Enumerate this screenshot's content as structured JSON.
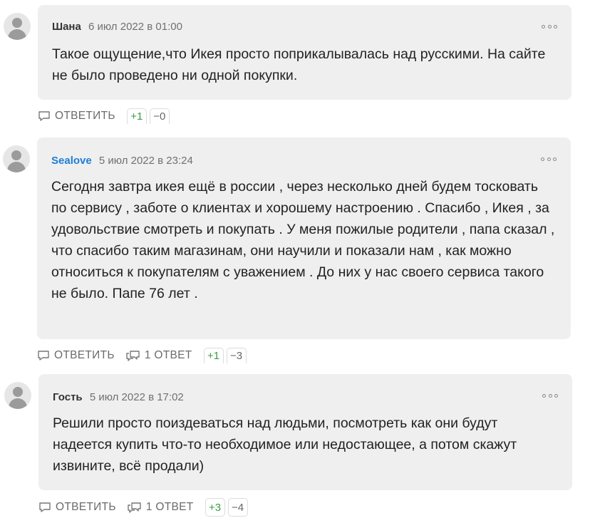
{
  "reply_label": "ОТВЕТИТЬ",
  "comments": [
    {
      "author": "Шана",
      "date": "6 июл 2022 в 01:00",
      "text": "Такое ощущение,что Икея просто поприкалывалась над русскими. На сайте не было проведено ни одной покупки.",
      "replies": "",
      "upvotes": "+1",
      "downvotes": "−0"
    },
    {
      "author": "Sealove",
      "date": "5 июл 2022 в 23:24",
      "text": "Сегодня завтра икея ещё в россии , через несколько дней будем тосковать по сервису , заботе о клиентах и хорошему настроению . Спасибо , Икея , за удовольствие смотреть и покупать . У меня пожилые родители , папа сказал , что спасибо таким магазинам, они научили и показали нам , как можно относиться к покупателям с уважением . До них у нас своего сервиса такого не было. Папе 76 лет .",
      "replies": "1 ОТВЕТ",
      "upvotes": "+1",
      "downvotes": "−3"
    },
    {
      "author": "Гость",
      "date": "5 июл 2022 в 17:02",
      "text": "Решили просто поиздеваться над людьми, посмотреть как они будут надеется купить что-то необходимое или недостающее, а потом скажут извините, всё продали)",
      "replies": "1 ОТВЕТ",
      "upvotes": "+3",
      "downvotes": "−4"
    }
  ]
}
